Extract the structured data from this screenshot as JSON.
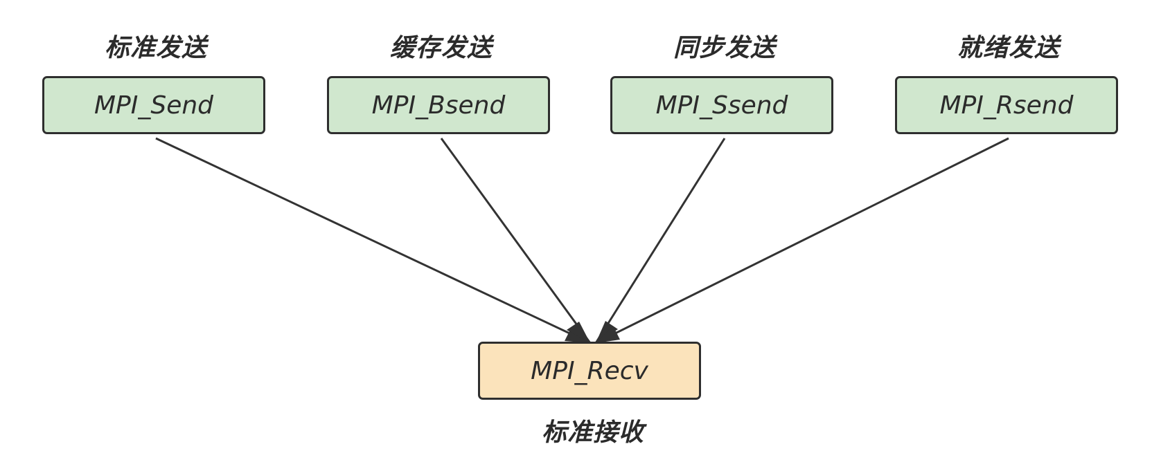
{
  "senders": [
    {
      "caption": "标准发送",
      "func": "MPI_Send"
    },
    {
      "caption": "缓存发送",
      "func": "MPI_Bsend"
    },
    {
      "caption": "同步发送",
      "func": "MPI_Ssend"
    },
    {
      "caption": "就绪发送",
      "func": "MPI_Rsend"
    }
  ],
  "receiver": {
    "func": "MPI_Recv",
    "caption": "标准接收"
  },
  "colors": {
    "send_fill": "#d0e7ce",
    "recv_fill": "#fbe3bb",
    "stroke": "#2e2e2e"
  }
}
